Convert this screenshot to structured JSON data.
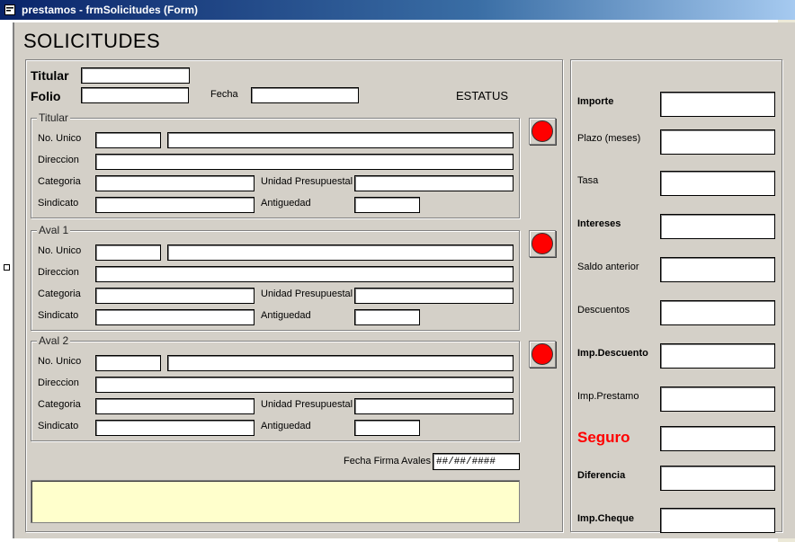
{
  "window": {
    "title": "prestamos - frmSolicitudes (Form)"
  },
  "form": {
    "heading": "SOLICITUDES",
    "titular_label": "Titular",
    "folio_label": "Folio",
    "fecha_label": "Fecha",
    "estatus_label": "ESTATUS",
    "titular_value": "",
    "folio_value": "",
    "fecha_value": ""
  },
  "groups": [
    {
      "title": "Titular",
      "labels": {
        "no_unico": "No. Unico",
        "direccion": "Direccion",
        "categoria": "Categoria",
        "unidad": "Unidad Presupuestal",
        "sindicato": "Sindicato",
        "antiguedad": "Antiguedad"
      }
    },
    {
      "title": "Aval 1",
      "labels": {
        "no_unico": "No. Unico",
        "direccion": "Direccion",
        "categoria": "Categoria",
        "unidad": "Unidad Presupuestal",
        "sindicato": "Sindicato",
        "antiguedad": "Antiguedad"
      }
    },
    {
      "title": "Aval 2",
      "labels": {
        "no_unico": "No. Unico",
        "direccion": "Direccion",
        "categoria": "Categoria",
        "unidad": "Unidad Presupuestal",
        "sindicato": "Sindicato",
        "antiguedad": "Antiguedad"
      }
    }
  ],
  "fecha_firma": {
    "label": "Fecha Firma Avales",
    "value": "##/##/####"
  },
  "right_panel": {
    "fields": [
      {
        "label": "Importe",
        "bold": true
      },
      {
        "label": "Plazo (meses)",
        "bold": false
      },
      {
        "label": "Tasa",
        "bold": false
      },
      {
        "label": "Intereses",
        "bold": true
      },
      {
        "label": "Saldo anterior",
        "bold": false
      },
      {
        "label": "Descuentos",
        "bold": false
      },
      {
        "label": "Imp.Descuento",
        "bold": true
      },
      {
        "label": "Imp.Prestamo",
        "bold": false
      },
      {
        "label": "Seguro",
        "bold": true,
        "color": "#ff0000"
      },
      {
        "label": "Diferencia",
        "bold": true
      },
      {
        "label": "Imp.Cheque",
        "bold": true
      }
    ]
  },
  "colors": {
    "status_indicator": "#ff0000",
    "notes_background": "#ffffcc",
    "form_background": "#d4d0c8"
  },
  "icons": {
    "app": "form-icon",
    "status": "red-circle-icon"
  }
}
